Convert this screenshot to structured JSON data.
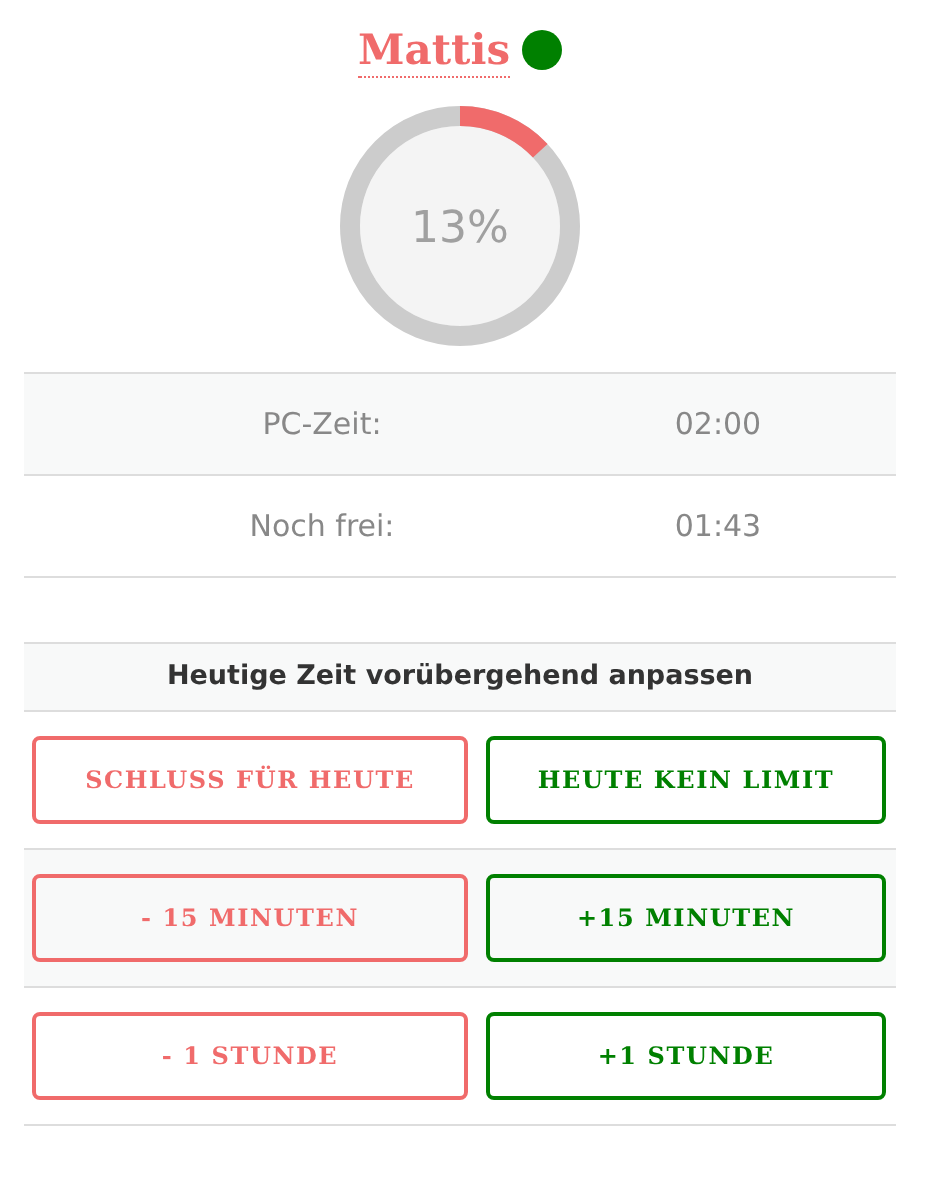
{
  "user": {
    "name": "Mattis",
    "online": true
  },
  "usage": {
    "level": 0.13,
    "percent": "13%"
  },
  "stats": [
    {
      "label": "PC-Zeit:",
      "value": "02:00"
    },
    {
      "label": "Noch frei:",
      "value": "01:43"
    }
  ],
  "adjust": {
    "title": "Heutige Zeit vorübergehend anpassen",
    "rows": [
      [
        {
          "label": "SCHLUSS FÜR HEUTE",
          "color": "#f06b6b"
        },
        {
          "label": "HEUTE KEIN LIMIT",
          "color": "#008000"
        }
      ],
      [
        {
          "label": "- 15 MINUTEN",
          "color": "#f06b6b"
        },
        {
          "label": "+15 MINUTEN",
          "color": "#008000"
        }
      ],
      [
        {
          "label": "- 1 STUNDE",
          "color": "#f06b6b"
        },
        {
          "label": "+1 STUNDE",
          "color": "#008000"
        }
      ]
    ]
  }
}
